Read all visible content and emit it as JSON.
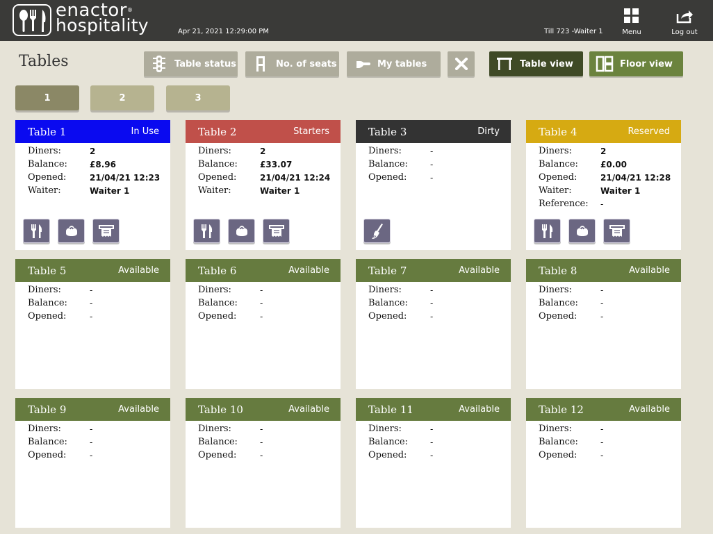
{
  "header": {
    "brand_line1": "enactor",
    "brand_line2": "hospitality",
    "brand_tm": "®",
    "datetime": "Apr 21, 2021 12:29:00 PM",
    "till": "Till 723 -Waiter 1",
    "menu_label": "Menu",
    "logout_label": "Log out"
  },
  "page_title": "Tables",
  "toolbar": {
    "table_status": "Table status",
    "no_of_seats": "No. of seats",
    "my_tables": "My tables",
    "table_view": "Table view",
    "floor_view": "Floor view"
  },
  "page_tabs": [
    "1",
    "2",
    "3"
  ],
  "labels": {
    "diners": "Diners:",
    "balance": "Balance:",
    "opened": "Opened:",
    "waiter": "Waiter:",
    "reference": "Reference:"
  },
  "colors": {
    "in_use": "#0a0af0",
    "starters": "#c0504a",
    "dirty": "#333333",
    "reserved": "#d6aa12",
    "available": "#667b3f",
    "action_button": "#6b6782"
  },
  "tables": [
    {
      "name": "Table 1",
      "status": "In Use",
      "diners": "2",
      "balance": "£8.96",
      "opened": "21/04/21 12:23",
      "waiter": "Waiter 1",
      "actions": [
        "cutlery-icon",
        "purse-icon",
        "receipt-icon"
      ]
    },
    {
      "name": "Table 2",
      "status": "Starters",
      "diners": "2",
      "balance": "£33.07",
      "opened": "21/04/21 12:24",
      "waiter": "Waiter 1",
      "actions": [
        "cutlery-icon",
        "purse-icon",
        "receipt-icon"
      ]
    },
    {
      "name": "Table 3",
      "status": "Dirty",
      "diners": "-",
      "balance": "-",
      "opened": "-",
      "actions": [
        "broom-icon"
      ]
    },
    {
      "name": "Table 4",
      "status": "Reserved",
      "diners": "2",
      "balance": "£0.00",
      "opened": "21/04/21 12:28",
      "waiter": "Waiter 1",
      "reference": "-",
      "actions": [
        "cutlery-icon",
        "purse-icon",
        "receipt-icon"
      ]
    },
    {
      "name": "Table 5",
      "status": "Available",
      "diners": "-",
      "balance": "-",
      "opened": "-"
    },
    {
      "name": "Table 6",
      "status": "Available",
      "diners": "-",
      "balance": "-",
      "opened": "-"
    },
    {
      "name": "Table 7",
      "status": "Available",
      "diners": "-",
      "balance": "-",
      "opened": "-"
    },
    {
      "name": "Table 8",
      "status": "Available",
      "diners": "-",
      "balance": "-",
      "opened": "-"
    },
    {
      "name": "Table 9",
      "status": "Available",
      "diners": "-",
      "balance": "-",
      "opened": "-"
    },
    {
      "name": "Table 10",
      "status": "Available",
      "diners": "-",
      "balance": "-",
      "opened": "-"
    },
    {
      "name": "Table 11",
      "status": "Available",
      "diners": "-",
      "balance": "-",
      "opened": "-"
    },
    {
      "name": "Table 12",
      "status": "Available",
      "diners": "-",
      "balance": "-",
      "opened": "-"
    }
  ]
}
